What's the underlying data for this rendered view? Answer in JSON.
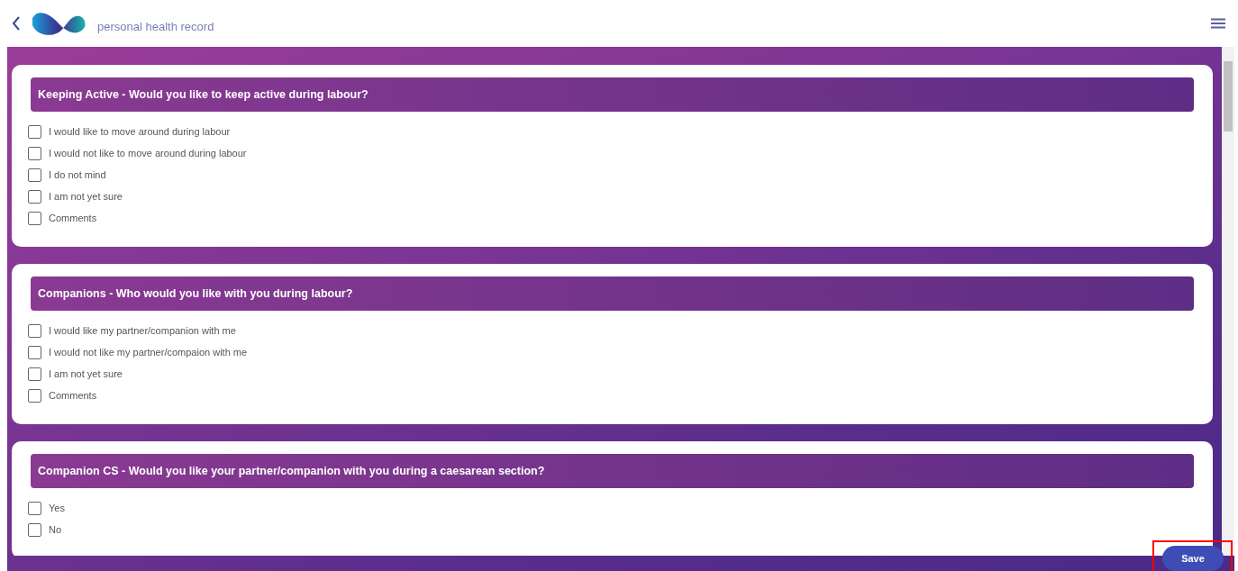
{
  "header": {
    "title": "personal health record"
  },
  "sections": [
    {
      "heading": "Keeping Active - Would you like to keep active during labour?",
      "options": [
        {
          "label": "I would like to move around during labour",
          "checked": false
        },
        {
          "label": "I would not like to move around during labour",
          "checked": false
        },
        {
          "label": "I do not mind",
          "checked": false
        },
        {
          "label": "I am not yet sure",
          "checked": false
        },
        {
          "label": "Comments",
          "checked": false
        }
      ]
    },
    {
      "heading": "Companions - Who would you like with you during labour?",
      "options": [
        {
          "label": "I would like my partner/companion with me",
          "checked": false
        },
        {
          "label": "I would not like my partner/compaion with me",
          "checked": false
        },
        {
          "label": "I am not yet sure",
          "checked": false
        },
        {
          "label": "Comments",
          "checked": false
        }
      ]
    },
    {
      "heading": "Companion CS - Would you like your partner/companion with you during a caesarean section?",
      "options": [
        {
          "label": "Yes",
          "checked": false
        },
        {
          "label": "No",
          "checked": false
        }
      ]
    }
  ],
  "save_button": "Save"
}
